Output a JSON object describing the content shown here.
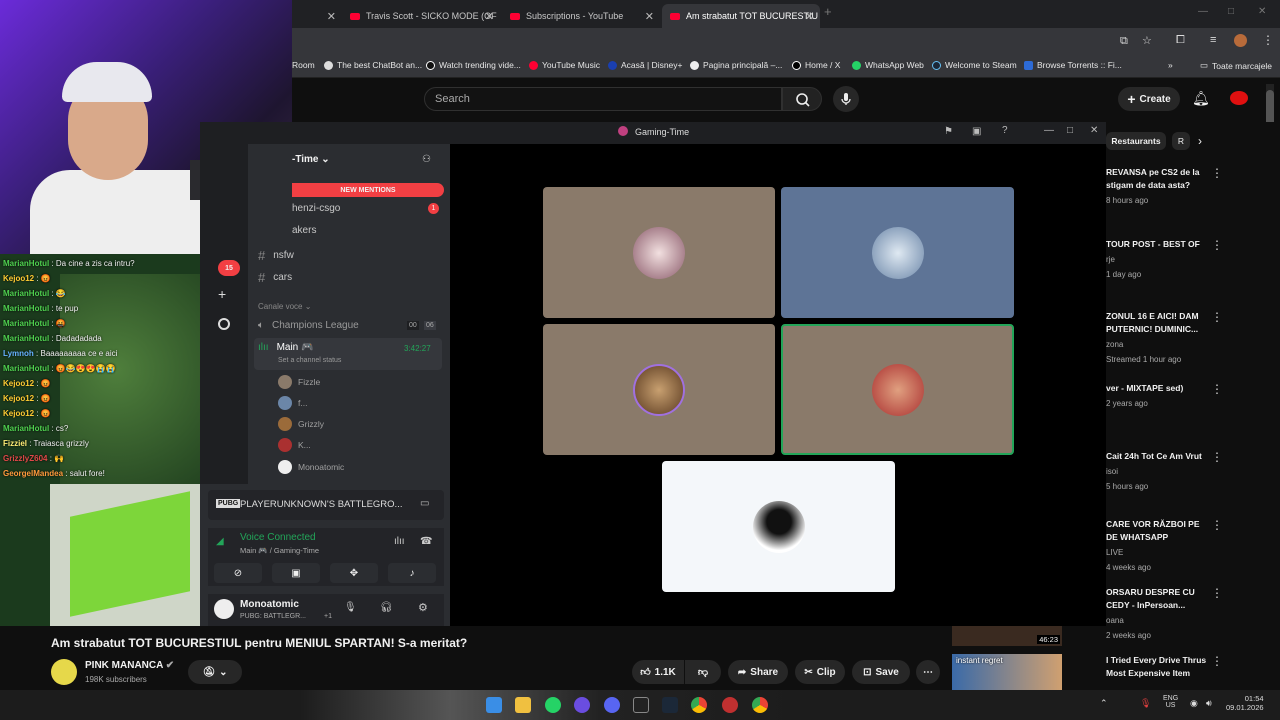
{
  "tabs": [
    {
      "label": "Travis Scott - SICKO MODE (OF"
    },
    {
      "label": "Subscriptions - YouTube"
    },
    {
      "label": "Am strabatut TOT BUCURESTIU"
    }
  ],
  "bookmarks": {
    "items": [
      "Room",
      "The best ChatBot an...",
      "Watch trending vide...",
      "YouTube Music",
      "Acasă | Disney+",
      "Pagina principală –...",
      "Home / X",
      "WhatsApp Web",
      "Welcome to Steam",
      "Browse Torrents :: Fi..."
    ],
    "all": "Toate marcajele"
  },
  "youtube": {
    "search_placeholder": "Search",
    "create": "Create",
    "chip_restaurants": "Restaurants",
    "chip_more": "R"
  },
  "chat": [
    {
      "user": "MarianHotul",
      "color": "#4fd14f",
      "text": "Da cine a zis ca intru?"
    },
    {
      "user": "Kejoo12",
      "color": "#ffcc33",
      "text": "😡"
    },
    {
      "user": "MarianHotul",
      "color": "#4fd14f",
      "text": "😂"
    },
    {
      "user": "MarianHotul",
      "color": "#4fd14f",
      "text": "te pup"
    },
    {
      "user": "MarianHotul",
      "color": "#4fd14f",
      "text": "🤬"
    },
    {
      "user": "MarianHotul",
      "color": "#4fd14f",
      "text": "Dadadadada"
    },
    {
      "user": "Lymnoh",
      "color": "#66b3ff",
      "text": "Baaaaaaaaa ce e aici"
    },
    {
      "user": "MarianHotul",
      "color": "#4fd14f",
      "text": "😡😂😍😍😭😭"
    },
    {
      "user": "Kejoo12",
      "color": "#ffcc33",
      "text": "😡"
    },
    {
      "user": "Kejoo12",
      "color": "#ffcc33",
      "text": "😡"
    },
    {
      "user": "Kejoo12",
      "color": "#ffcc33",
      "text": "😡"
    },
    {
      "user": "MarianHotul",
      "color": "#4fd14f",
      "text": "cs?"
    },
    {
      "user": "Fizziel",
      "color": "#ffee77",
      "text": "Traiasca grizzly"
    },
    {
      "user": "GrizzlyZ604",
      "color": "#e04848",
      "text": "🙌"
    },
    {
      "user": "GeorgelMandea",
      "color": "#ff9a3c",
      "text": "salut fore!"
    }
  ],
  "discord": {
    "window_title": "Gaming-Time",
    "server_name": "-Time",
    "new_mentions": "NEW MENTIONS",
    "badge_count": "15",
    "channels": [
      {
        "name": "henzi-csgo",
        "badge": "1"
      },
      {
        "name": "akers"
      },
      {
        "name": "nsfw"
      },
      {
        "name": "cars"
      }
    ],
    "voice_section": "Canale voce",
    "voice_channels": [
      {
        "name": "Champions League",
        "left": "00",
        "right": "06"
      },
      {
        "name": "Main 🎮",
        "time": "3:42:27",
        "status": "Set a channel status"
      }
    ],
    "members": [
      "Fizzle",
      "f...",
      "Grizzly",
      "K...",
      "Monoatomic"
    ],
    "game": "PLAYERUNKNOWN'S BATTLEGRO...",
    "voice_connected": "Voice Connected",
    "voice_where": "Main 🎮 / Gaming-Time",
    "user_name": "Monoatomic",
    "user_status": "PUBG: BATTLEGR...",
    "user_plus": "+1"
  },
  "recommendations": [
    {
      "title": "REVANSA pe CS2 de la stigam de data asta?",
      "meta1": "",
      "meta2": "8 hours ago"
    },
    {
      "title": "TOUR POST - BEST OF",
      "meta1": "rje",
      "meta2": "1 day ago"
    },
    {
      "title": "ZONUL 16 E AICI! DAM PUTERNIC! DUMINIC...",
      "meta1": "zona",
      "meta2": "Streamed 1 hour ago"
    },
    {
      "title": "ver - MIXTAPE sed)",
      "meta1": "",
      "meta2": "2 years ago"
    },
    {
      "title": "Cait 24h Tot Ce Am Vrut",
      "meta1": "isoi",
      "meta2": "5 hours ago"
    },
    {
      "title": "CARE VOR RĂZBOI PE DE WHATSAPP",
      "meta1": "LIVE",
      "meta2": "4 weeks ago"
    },
    {
      "title": "ORSARU DESPRE CU CEDY - InPersoan...",
      "meta1": "oana",
      "meta2": "2 weeks ago"
    },
    {
      "title": "I Tried Every Drive Thrus Most Expensive Item",
      "meta1": "",
      "meta2": ""
    }
  ],
  "thumbs": {
    "duration": "46:23",
    "instant_regret": "instant regret"
  },
  "video": {
    "title": "Am strabatut TOT BUCURESTIUL pentru MENIUL SPARTAN! S-a meritat?",
    "channel": "PINK MANANCA",
    "subscribers": "198K subscribers",
    "likes": "1.1K",
    "share": "Share",
    "clip": "Clip",
    "save": "Save"
  },
  "tray": {
    "lang1": "ENG",
    "lang2": "US",
    "time": "01:54",
    "date": "09.01.2026"
  },
  "colors": {
    "accent": "#ff0033",
    "discord_green": "#23a559",
    "mention_red": "#f23f43"
  }
}
